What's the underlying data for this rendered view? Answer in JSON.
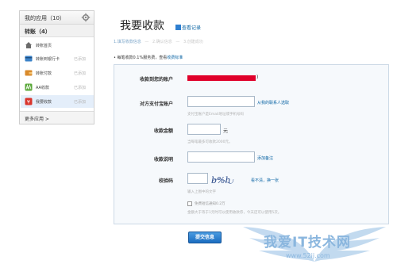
{
  "sidebar": {
    "title": "我的应用（10）",
    "group": "转账（4）",
    "items": [
      {
        "label": "转账首页",
        "status": ""
      },
      {
        "label": "转账到银行卡",
        "status": "已添加"
      },
      {
        "label": "转账付款",
        "status": "已添加"
      },
      {
        "label": "AA收款",
        "status": "已添加"
      },
      {
        "label": "我要收款",
        "status": "已添加"
      }
    ],
    "more": "更多应用 >"
  },
  "header": {
    "title": "我要收款",
    "records_link": "查看记录",
    "steps": [
      "1.填写收款信息",
      "2.确认信息",
      "3.创建成功"
    ],
    "fee_text": "• 每笔收款0.1%服务费，查看",
    "fee_link": "收费标准"
  },
  "form": {
    "account_label": "收款到您的账户",
    "account_suffix": ")",
    "payer_label": "对方支付宝账户",
    "payer_link": "从我的联系人选取",
    "payer_hint": "支付宝账户是Email地址或手机号码",
    "amount_label": "收款金额",
    "amount_unit": "元",
    "amount_hint": "当每笔最多可收款2000元。",
    "desc_label": "收款说明",
    "desc_link": "添加备注",
    "captcha_label": "校验码",
    "captcha_text": "b%h",
    "captcha_link": "看不清，换一张",
    "captcha_hint": "输入上图中的文字",
    "notify_text": "免费短信通知0.2万",
    "notify_hint": "金额大于等于1元时可以使用收款券，今天还可以使用5次。",
    "submit_label": "提交信息"
  },
  "watermark": {
    "text": "我爱IT技术网",
    "url": "www.52ij.com"
  },
  "colors": {
    "link": "#0a64a4",
    "submit": "#1a6cc0",
    "panel_bg": "#f6f9fc",
    "redaction": "#e0002a",
    "watermark": "#8ab6de"
  }
}
